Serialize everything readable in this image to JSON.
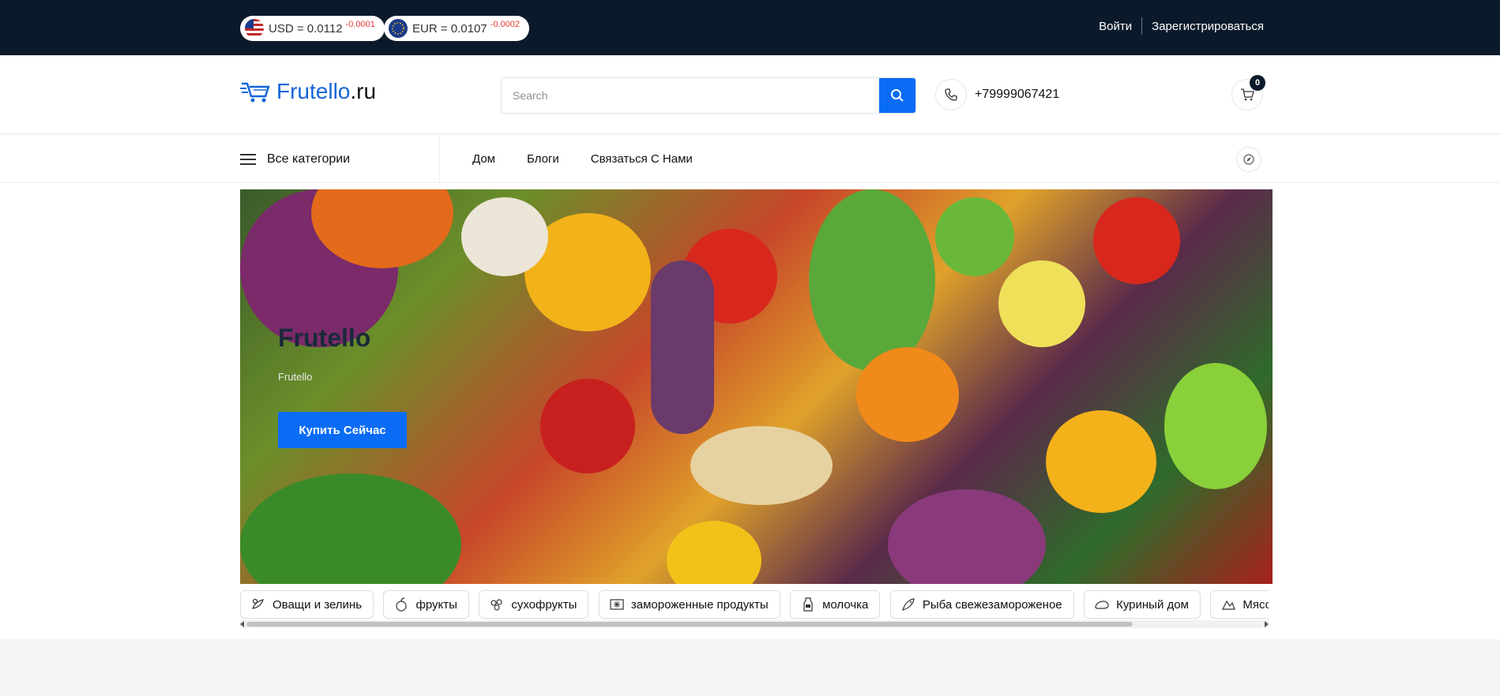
{
  "topbar": {
    "rates": [
      {
        "label": "USD = 0.0112",
        "delta": "-0.0001",
        "flag": "us-flag-icon"
      },
      {
        "label": "EUR = 0.0107",
        "delta": "-0.0002",
        "flag": "eu-flag-icon"
      }
    ],
    "login": "Войти",
    "register": "Зарегистрироваться"
  },
  "header": {
    "logo_brand": "Frutello",
    "logo_tld": ".ru",
    "search_placeholder": "Search",
    "phone": "+79999067421",
    "cart_count": "0"
  },
  "nav": {
    "all_categories": "Все категории",
    "links": [
      "Дом",
      "Блоги",
      "Связаться С Нами"
    ]
  },
  "hero": {
    "title": "Frutello",
    "subtitle": "Frutello",
    "button": "Купить Сейчас"
  },
  "categories": [
    {
      "label": "Оващи и зелинь",
      "icon": "vegetables-icon"
    },
    {
      "label": "фрукты",
      "icon": "fruits-icon"
    },
    {
      "label": "сухофрукты",
      "icon": "dried-fruits-icon"
    },
    {
      "label": "замороженные продукты",
      "icon": "frozen-food-icon"
    },
    {
      "label": "молочка",
      "icon": "milk-icon"
    },
    {
      "label": "Рыба свежезамороженое",
      "icon": "fish-icon"
    },
    {
      "label": "Куриный дом",
      "icon": "chicken-icon"
    },
    {
      "label": "Мясо",
      "icon": "meat-icon"
    }
  ],
  "colors": {
    "topbar_bg": "#0b1a2b",
    "accent": "#0a6cf5",
    "delta": "#e53935"
  }
}
